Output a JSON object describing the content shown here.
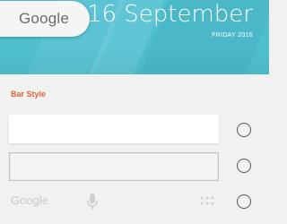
{
  "header": {
    "search_logo": "Google",
    "date": "16 September",
    "weekday_year": "FRIDAY 2016",
    "accent_color": "#4fbfd0"
  },
  "settings": {
    "section_title": "Bar Style",
    "section_title_color": "#e0643a",
    "options": [
      {
        "style": "solid-white",
        "selected": false
      },
      {
        "style": "outlined",
        "selected": false
      },
      {
        "style": "transparent",
        "selected": false,
        "logo": "Google",
        "icons": [
          "mic-icon",
          "dots-icon"
        ]
      }
    ]
  }
}
